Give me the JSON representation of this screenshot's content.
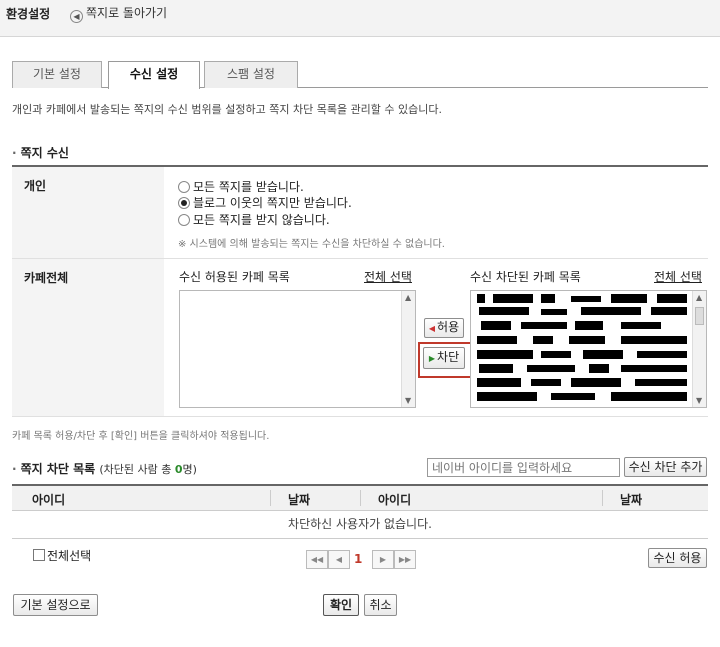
{
  "header": {
    "title": "환경설정",
    "back_icon": "chevron-left-icon",
    "back_label": "쪽지로 돌아가기"
  },
  "tabs": [
    {
      "label": "기본 설정",
      "active": false
    },
    {
      "label": "수신 설정",
      "active": true
    },
    {
      "label": "스팸 설정",
      "active": false
    }
  ],
  "description": "개인과 카페에서 발송되는 쪽지의 수신 범위를 설정하고 쪽지 차단 목록을 관리할 수 있습니다.",
  "receive": {
    "section_title": "쪽지 수신",
    "personal": {
      "label": "개인",
      "options": [
        {
          "label": "모든 쪽지를 받습니다.",
          "selected": false
        },
        {
          "label": "블로그 이웃의 쪽지만 받습니다.",
          "selected": true
        },
        {
          "label": "모든 쪽지를 받지 않습니다.",
          "selected": false
        }
      ],
      "note": "※ 시스템에 의해 발송되는 쪽지는 수신을 차단하실 수 없습니다."
    },
    "cafe": {
      "label": "카페전체",
      "allowed_title": "수신 허용된 카페 목록",
      "blocked_title": "수신 차단된 카페 목록",
      "select_all": "전체 선택",
      "allow_button": "허용",
      "block_button": "차단",
      "footnote": "카페 목록 허용/차단 후 [확인] 버튼을 클릭하셔야 적용됩니다."
    }
  },
  "block_list": {
    "section_title": "쪽지 차단 목록",
    "count_prefix": "(차단된 사람 총 ",
    "count": "0",
    "count_suffix": "명)",
    "input_placeholder": "네이버 아이디를 입력하세요",
    "add_button": "수신 차단 추가",
    "columns": [
      "아이디",
      "날짜",
      "아이디",
      "날짜"
    ],
    "empty_message": "차단하신 사용자가 없습니다.",
    "select_all": "전체선택",
    "allow_button": "수신 허용",
    "pager": {
      "current": "1"
    }
  },
  "footer": {
    "default_button": "기본 설정으로",
    "confirm_button": "확인",
    "cancel_button": "취소"
  }
}
